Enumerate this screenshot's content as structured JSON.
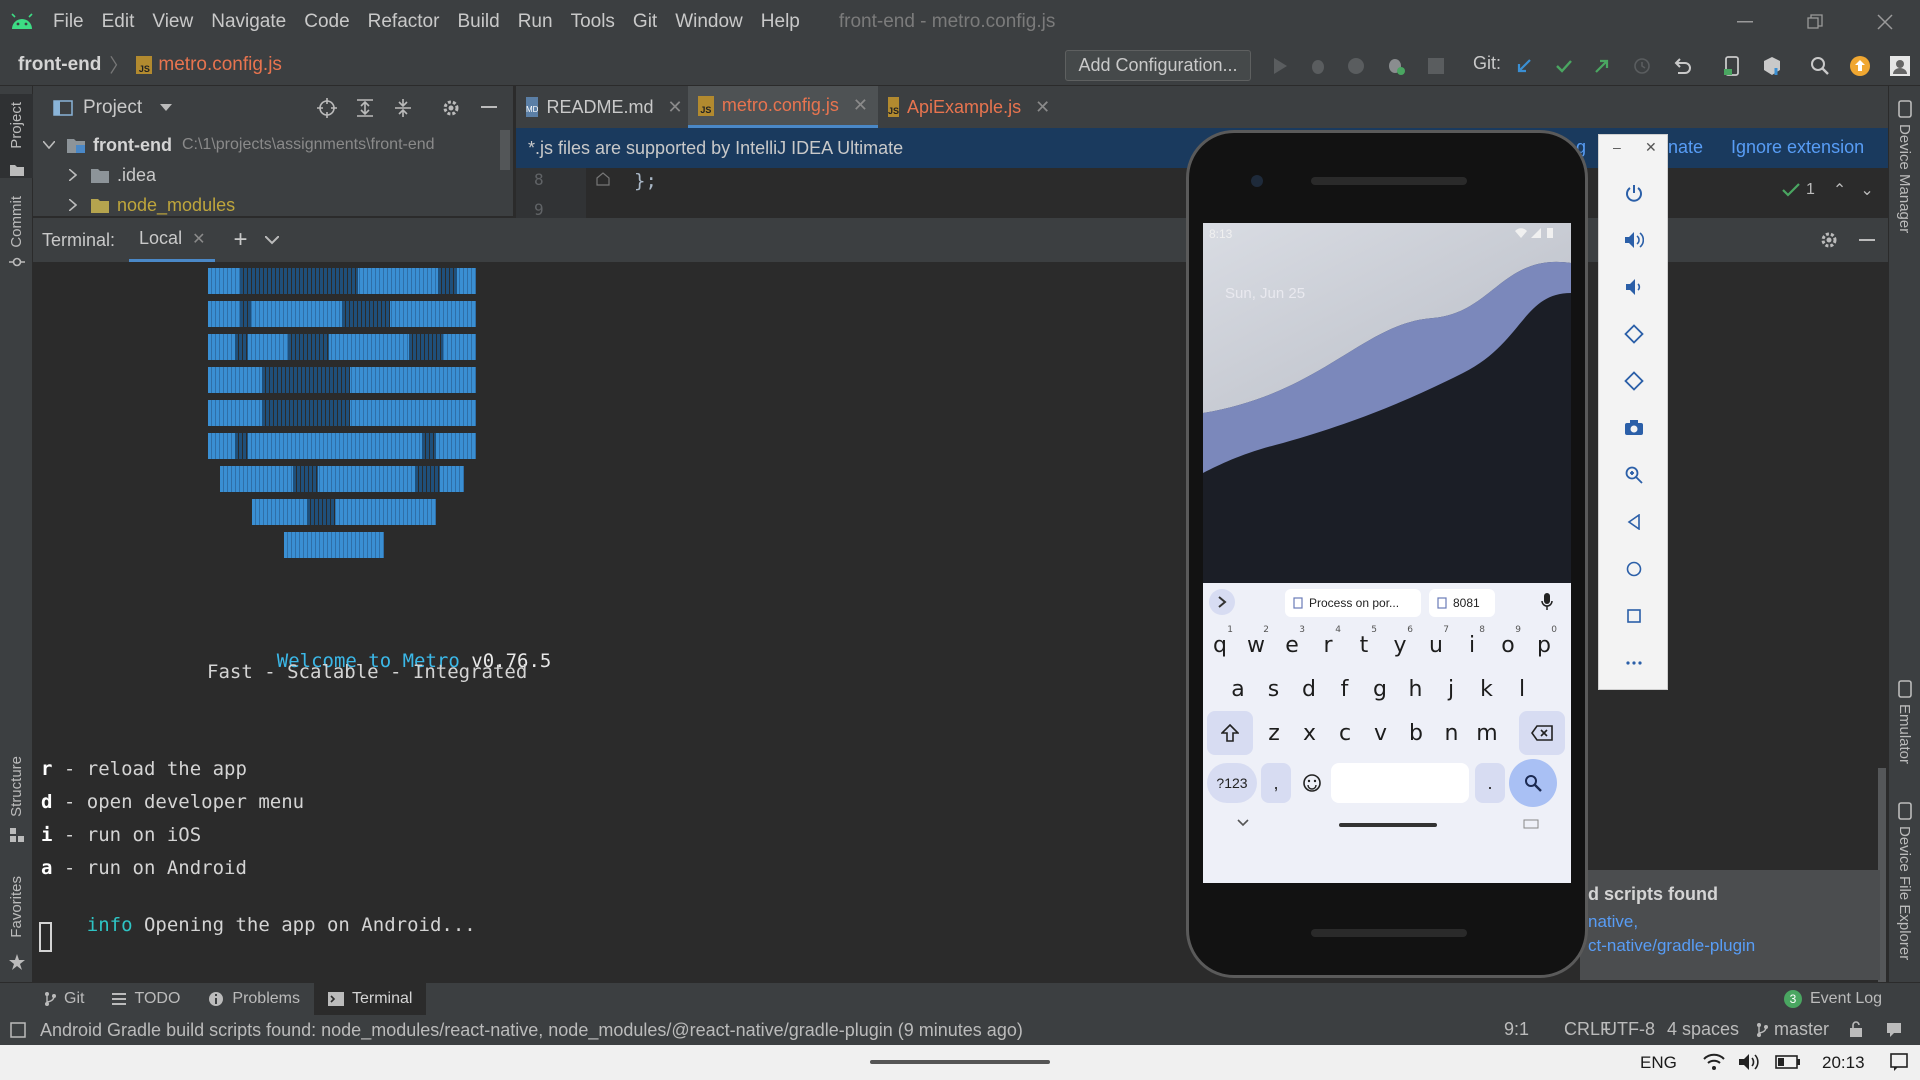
{
  "window": {
    "title": "front-end - metro.config.js",
    "menu": [
      "File",
      "Edit",
      "View",
      "Navigate",
      "Code",
      "Refactor",
      "Build",
      "Run",
      "Tools",
      "Git",
      "Window",
      "Help"
    ]
  },
  "navbar": {
    "project": "front-end",
    "file": "metro.config.js",
    "add_configuration": "Add Configuration...",
    "git_label": "Git:"
  },
  "project_panel": {
    "title": "Project",
    "root_name": "front-end",
    "root_path": "C:\\1\\projects\\assignments\\front-end",
    "items": [
      ".idea",
      "node_modules"
    ]
  },
  "editor": {
    "tabs": [
      {
        "label": "README.md",
        "icon": "markdown-icon"
      },
      {
        "label": "metro.config.js",
        "icon": "js-file-icon"
      },
      {
        "label": "ApiExample.js",
        "icon": "js-file-icon"
      }
    ],
    "banner_text": "*.js files are supported by IntelliJ IDEA Ultimate",
    "banner_link_partial_1": "g",
    "banner_link_partial_2": "nate",
    "banner_ignore": "Ignore extension",
    "line_numbers": [
      "8",
      "9"
    ],
    "code_line": "};",
    "inspection_count": "1"
  },
  "terminal": {
    "label": "Terminal:",
    "tab": "Local",
    "welcome_prefix": "Welcome to Metro",
    "welcome_version": "v0.76.5",
    "tagline": "Fast - Scalable - Integrated",
    "commands": [
      {
        "key": "r",
        "desc": " - reload the app"
      },
      {
        "key": "d",
        "desc": " - open developer menu"
      },
      {
        "key": "i",
        "desc": " - run on iOS"
      },
      {
        "key": "a",
        "desc": " - run on Android"
      }
    ],
    "info_label": "info",
    "info_text": " Opening the app on Android..."
  },
  "notification": {
    "title_partial": "d scripts found",
    "link1_partial": "native,",
    "link2_partial": "ct-native/gradle-plugin"
  },
  "left_strip": {
    "project": "Project",
    "commit": "Commit",
    "structure": "Structure",
    "favorites": "Favorites"
  },
  "right_strip": {
    "device_manager": "Device Manager",
    "emulator": "Emulator",
    "device_file_explorer": "Device File Explorer"
  },
  "bottom_tabs": [
    {
      "label": "Git",
      "icon": "git-branch-icon"
    },
    {
      "label": "TODO",
      "icon": "list-icon"
    },
    {
      "label": "Problems",
      "icon": "info-icon"
    },
    {
      "label": "Terminal",
      "icon": "terminal-icon"
    }
  ],
  "event_log": {
    "count": "3",
    "label": "Event Log"
  },
  "status": {
    "message": "Android Gradle build scripts found: node_modules/react-native, node_modules/@react-native/gradle-plugin (9 minutes ago)",
    "position": "9:1",
    "line_sep": "CRLF",
    "encoding": "UTF-8",
    "indent": "4 spaces",
    "branch": "master"
  },
  "taskbar": {
    "lang": "ENG",
    "time": "20:13"
  },
  "phone": {
    "time": "8:13",
    "date": "Sun, Jun 25",
    "suggestions": [
      "Process on por...",
      "8081"
    ],
    "row1": [
      [
        "q",
        "1"
      ],
      [
        "w",
        "2"
      ],
      [
        "e",
        "3"
      ],
      [
        "r",
        "4"
      ],
      [
        "t",
        "5"
      ],
      [
        "y",
        "6"
      ],
      [
        "u",
        "7"
      ],
      [
        "i",
        "8"
      ],
      [
        "o",
        "9"
      ],
      [
        "p",
        "0"
      ]
    ],
    "row2": [
      "a",
      "s",
      "d",
      "f",
      "g",
      "h",
      "j",
      "k",
      "l"
    ],
    "row3": [
      "z",
      "x",
      "c",
      "v",
      "b",
      "n",
      "m"
    ],
    "sym_key": "?123",
    "comma": ",",
    "period": "."
  },
  "colors": {
    "ide_bg": "#2b2b2b",
    "panel_bg": "#3c3f41",
    "accent_blue": "#3a8fd3",
    "active_file": "#e8744f",
    "info_cyan": "#2ec4c4"
  }
}
